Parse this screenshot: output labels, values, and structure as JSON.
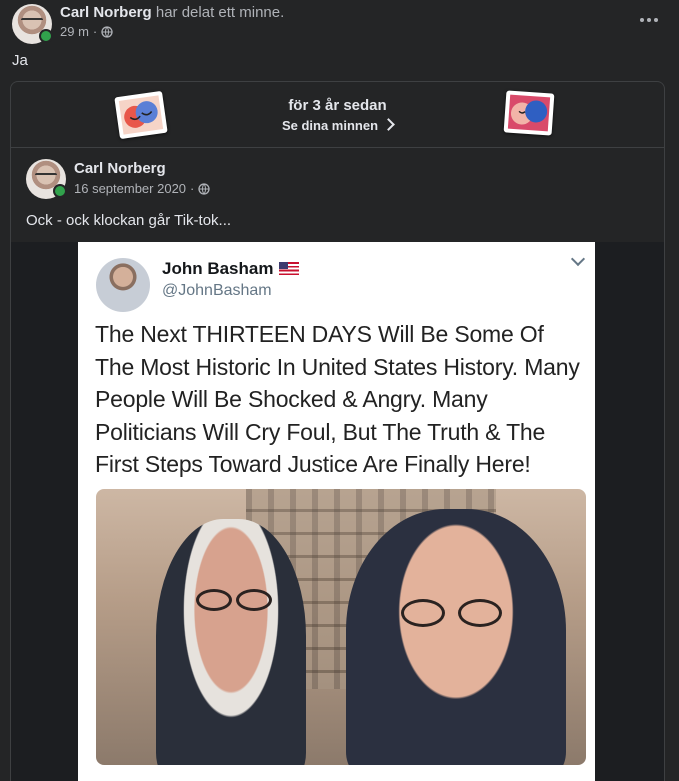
{
  "post": {
    "author": "Carl Norberg",
    "action": "har delat ett minne.",
    "time": "29 m",
    "separator": "·",
    "text": "Ja"
  },
  "memory": {
    "title": "för 3 år sedan",
    "link_label": "Se dina minnen"
  },
  "original_post": {
    "author": "Carl Norberg",
    "date": "16 september 2020",
    "separator": "·",
    "text": "Ock - ock klockan går Tik-tok..."
  },
  "tweet": {
    "name": "John Basham",
    "handle": "@JohnBasham",
    "body": "The Next THIRTEEN DAYS Will Be Some Of The Most Historic In United States History. Many People Will Be Shocked & Angry. Many Politicians Will Cry Foul, But The Truth & The First Steps Toward Justice Are Finally Here!"
  },
  "icons": {
    "more": "more-dots-icon",
    "privacy": "globe-icon",
    "chevron": "chevron-right-icon",
    "status": "online-dot-icon",
    "flag": "us-flag-icon"
  },
  "colors": {
    "background": "#242526",
    "text_primary": "#e4e6eb",
    "text_secondary": "#b0b3b8",
    "online": "#31a24c"
  }
}
